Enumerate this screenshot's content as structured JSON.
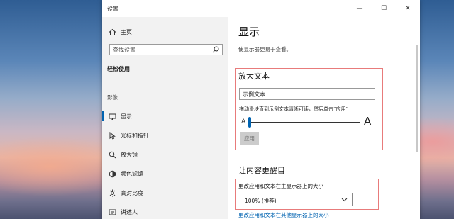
{
  "window": {
    "title": "设置",
    "controls": {
      "minimize": "—",
      "maximize": "☐",
      "close": "✕"
    }
  },
  "sidebar": {
    "home": {
      "label": "主页",
      "icon": "home-icon"
    },
    "search": {
      "placeholder": "查找设置",
      "icon": "search-icon"
    },
    "section_title": "轻松使用",
    "group_label": "影像",
    "items": [
      {
        "label": "显示",
        "icon": "monitor-icon",
        "active": true
      },
      {
        "label": "光标和指针",
        "icon": "pointer-icon"
      },
      {
        "label": "放大镜",
        "icon": "magnifier-icon"
      },
      {
        "label": "颜色滤镜",
        "icon": "color-filter-icon"
      },
      {
        "label": "高对比度",
        "icon": "contrast-icon"
      },
      {
        "label": "讲述人",
        "icon": "narrator-icon"
      }
    ]
  },
  "main": {
    "title": "显示",
    "description": "使显示器更易于查看。",
    "enlarge_text": {
      "heading": "放大文本",
      "sample_text": "示例文本",
      "hint": "拖动滑块直到示例文本清晰可读，然后单击“应用”",
      "slider_min_label": "A",
      "slider_max_label": "A",
      "slider_value_fraction": 0.0,
      "apply_label": "应用"
    },
    "make_everything_bigger": {
      "heading": "让内容更醒目",
      "label": "更改应用和文本在主显示器上的大小",
      "selected": "100% (推荐)",
      "link": "更改应用和文本在其他显示器上的大小"
    }
  },
  "colors": {
    "accent": "#0063b1",
    "highlight_border": "#e87b7b"
  }
}
